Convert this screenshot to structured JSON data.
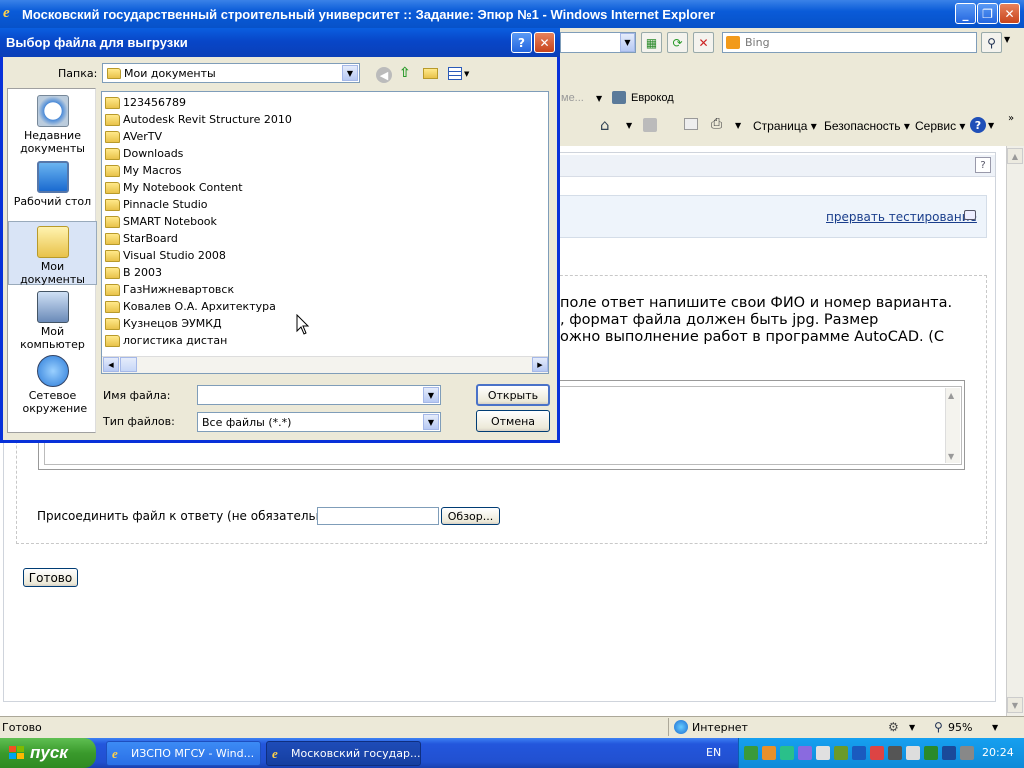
{
  "ie": {
    "title": "Московский государственный строительный университет :: Задание: Эпюр №1 - Windows Internet Explorer",
    "search_placeholder": "Bing",
    "favorites_link": "Еврокод",
    "favorites_truncated": "ме...",
    "cmd": {
      "page": "Страница",
      "security": "Безопасность",
      "tools": "Сервис"
    },
    "status": {
      "left": "Готово",
      "zone": "Интернет",
      "zoom": "95%"
    }
  },
  "page": {
    "cancel_link": "прервать тестирование",
    "task_lines": [
      "поле ответ напишите свои ФИО и номер варианта.",
      ", формат файла должен быть jpg. Размер",
      "ожно выполнение работ в программе AutoCAD. (С"
    ],
    "attach_label": "Присоединить файл к ответу (не обязательно):",
    "browse_button": "Обзор...",
    "done_button": "Готово"
  },
  "dialog": {
    "title": "Выбор файла для выгрузки",
    "folder_label": "Папка:",
    "current_folder": "Мои документы",
    "places": [
      {
        "label": "Недавние документы",
        "icon": "recent-documents-icon"
      },
      {
        "label": "Рабочий стол",
        "icon": "desktop-icon"
      },
      {
        "label": "Мои документы",
        "icon": "my-documents-icon"
      },
      {
        "label": "Мой компьютер",
        "icon": "my-computer-icon"
      },
      {
        "label": "Сетевое окружение",
        "icon": "network-icon"
      }
    ],
    "files": [
      "123456789",
      "Autodesk Revit Structure 2010",
      "AVerTV",
      "Downloads",
      "My Macros",
      "My Notebook Content",
      "Pinnacle Studio",
      "SMART Notebook",
      "StarBoard",
      "Visual Studio 2008",
      "В 2003",
      "ГазНижневартовск",
      "Ковалев О.А. Архитектура",
      "Кузнецов ЭУМКД",
      "логистика дистан"
    ],
    "filename_label": "Имя файла:",
    "filename_value": "",
    "filetype_label": "Тип файлов:",
    "filetype_value": "Все файлы (*.*)",
    "open_button": "Открыть",
    "cancel_button": "Отмена"
  },
  "taskbar": {
    "start": "пуск",
    "tasks": [
      "ИЗСПО МГСУ - Wind...",
      "Московский государ..."
    ],
    "lang": "EN",
    "clock": "20:24"
  }
}
